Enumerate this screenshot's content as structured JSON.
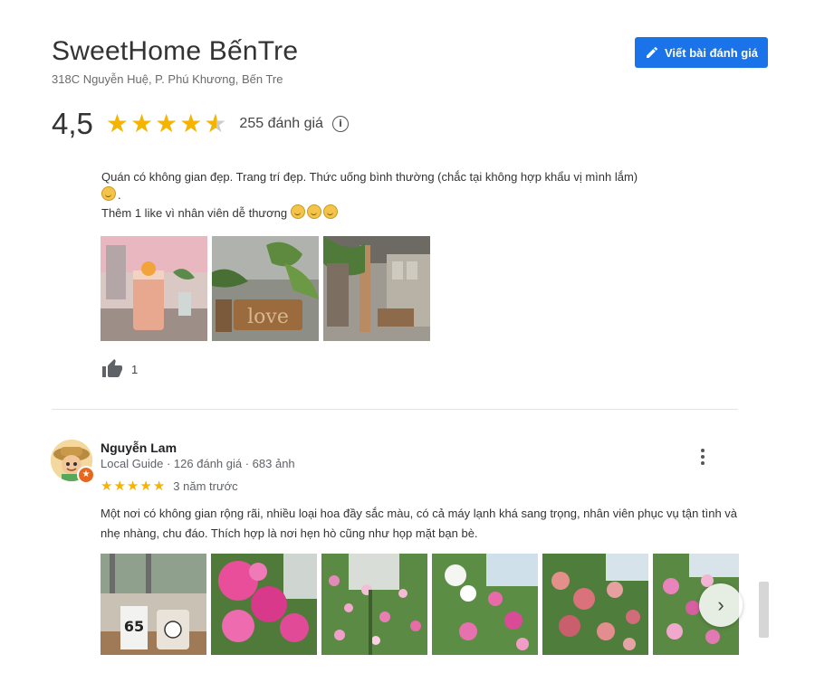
{
  "place": {
    "name": "SweetHome BếnTre",
    "address": "318C Nguyễn Huệ, P. Phú Khương, Bến Tre",
    "write_review_label": "Viết bài đánh giá"
  },
  "rating": {
    "value": "4,5",
    "stars": 4.5,
    "count_label": "255 đánh giá",
    "info_icon": "info-icon"
  },
  "review1": {
    "line1": "Quán có không gian đẹp. Trang trí đẹp. Thức uống bình thường (chắc tại không hợp khẩu vị mình lắm)",
    "line2": ".",
    "line3": "Thêm 1 like vì nhân viên dễ thương",
    "likes": "1"
  },
  "review2": {
    "author": "Nguyễn Lam",
    "meta": "Local Guide · 126 đánh giá · 683 ảnh",
    "stars": 5,
    "time": "3 năm trước",
    "text": "Một nơi có không gian rộng rãi, nhiều loại hoa đầy sắc màu, có cả máy lạnh khá sang trọng, nhân viên phục vụ tận tình và nhẹ nhàng, chu đáo. Thích hợp là nơi hẹn hò cũng như họp mặt bạn bè.",
    "cup_label": "65"
  },
  "colors": {
    "accent": "#1a73e8",
    "star": "#f4b400",
    "badge": "#e8671e"
  }
}
